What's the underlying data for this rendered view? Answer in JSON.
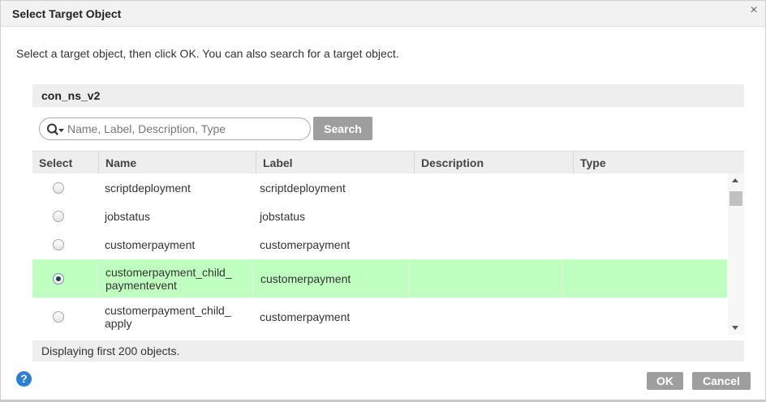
{
  "dialog": {
    "title": "Select Target Object",
    "close_glyph": "×",
    "instructions": "Select a target object, then click OK. You can also search for a target object."
  },
  "connection": {
    "name": "con_ns_v2"
  },
  "search": {
    "placeholder": "Name, Label, Description, Type",
    "value": "",
    "button_label": "Search",
    "icon": "search-icon"
  },
  "grid": {
    "columns": [
      "Select",
      "Name",
      "Label",
      "Description",
      "Type"
    ],
    "rows": [
      {
        "name": "scriptdeployment",
        "label": "scriptdeployment",
        "description": "",
        "type": "",
        "selected": false
      },
      {
        "name": "jobstatus",
        "label": "jobstatus",
        "description": "",
        "type": "",
        "selected": false
      },
      {
        "name": "customerpayment",
        "label": "customerpayment",
        "description": "",
        "type": "",
        "selected": false
      },
      {
        "name": "customerpayment_child_ paymentevent",
        "name_lines": [
          "customerpayment_child_",
          "paymentevent"
        ],
        "label": "customerpayment",
        "description": "",
        "type": "",
        "selected": true
      },
      {
        "name": "customerpayment_child_ apply",
        "name_lines": [
          "customerpayment_child_",
          "apply"
        ],
        "label": "customerpayment",
        "description": "",
        "type": "",
        "selected": false
      }
    ],
    "selected_row_color": "#bfffbf"
  },
  "status": {
    "text": "Displaying first 200 objects."
  },
  "footer": {
    "help_glyph": "?",
    "ok_label": "OK",
    "cancel_label": "Cancel"
  },
  "colors": {
    "button_gray": "#9e9e9e",
    "help_blue": "#2d7fd3"
  }
}
